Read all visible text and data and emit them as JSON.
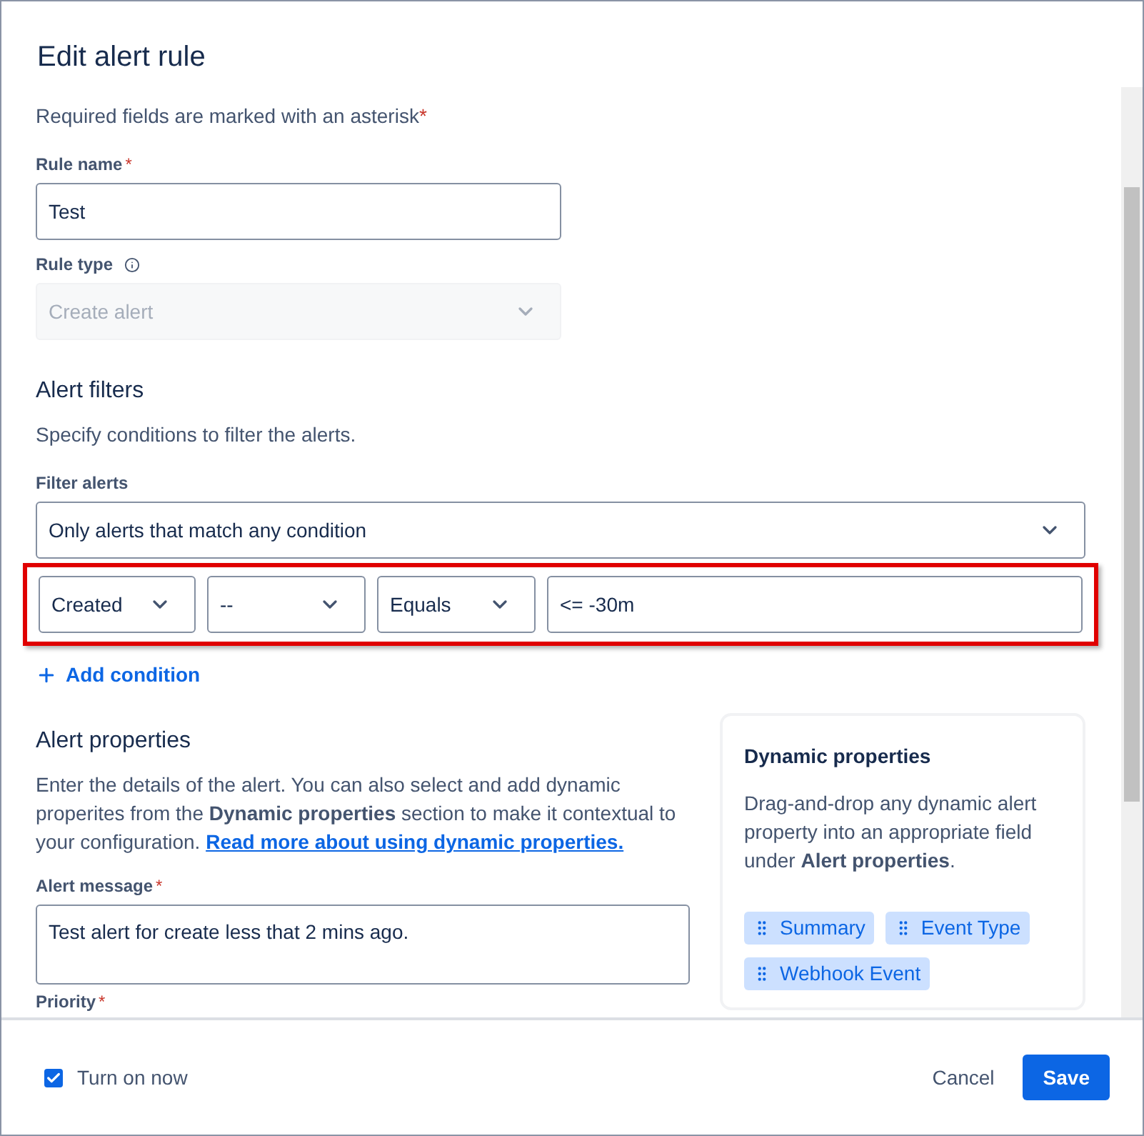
{
  "dialog": {
    "title": "Edit alert rule"
  },
  "required_note": {
    "text": "Required fields are marked with an asterisk",
    "asterisk": "*"
  },
  "rule_name": {
    "label": "Rule name",
    "asterisk": "*",
    "value": "Test"
  },
  "rule_type": {
    "label": "Rule type",
    "value": "Create alert",
    "disabled": true
  },
  "alert_filters": {
    "heading": "Alert filters",
    "description": "Specify conditions to filter the alerts.",
    "filter_label": "Filter alerts",
    "filter_value": "Only alerts that match any condition",
    "condition": [
      {
        "kind": "select",
        "value": "Created"
      },
      {
        "kind": "select",
        "value": "--"
      },
      {
        "kind": "select",
        "value": "Equals"
      },
      {
        "kind": "input",
        "value": "<= -30m"
      }
    ],
    "highlighted": true,
    "add_condition": "Add condition"
  },
  "alert_properties": {
    "heading": "Alert properties",
    "description": "Enter the details of the alert. You can also select and add dynamic properites from the **Dynamic properties** section to make it contextual to your configuration.",
    "link": "Read more about using dynamic properties.",
    "message_label": "Alert message",
    "message_asterisk": "*",
    "message_value": "Test alert for create less that 2 mins ago.",
    "priority_label": "Priority",
    "priority_asterisk": "*"
  },
  "dynamic_properties": {
    "title": "Dynamic properties",
    "description": "Drag-and-drop any dynamic alert property into an appropriate field under **Alert properties**.",
    "chips": [
      "Summary",
      "Event Type",
      "Webhook Event"
    ]
  },
  "footer": {
    "turn_on": {
      "label": "Turn on now",
      "checked": true
    },
    "cancel": "Cancel",
    "save": "Save"
  }
}
